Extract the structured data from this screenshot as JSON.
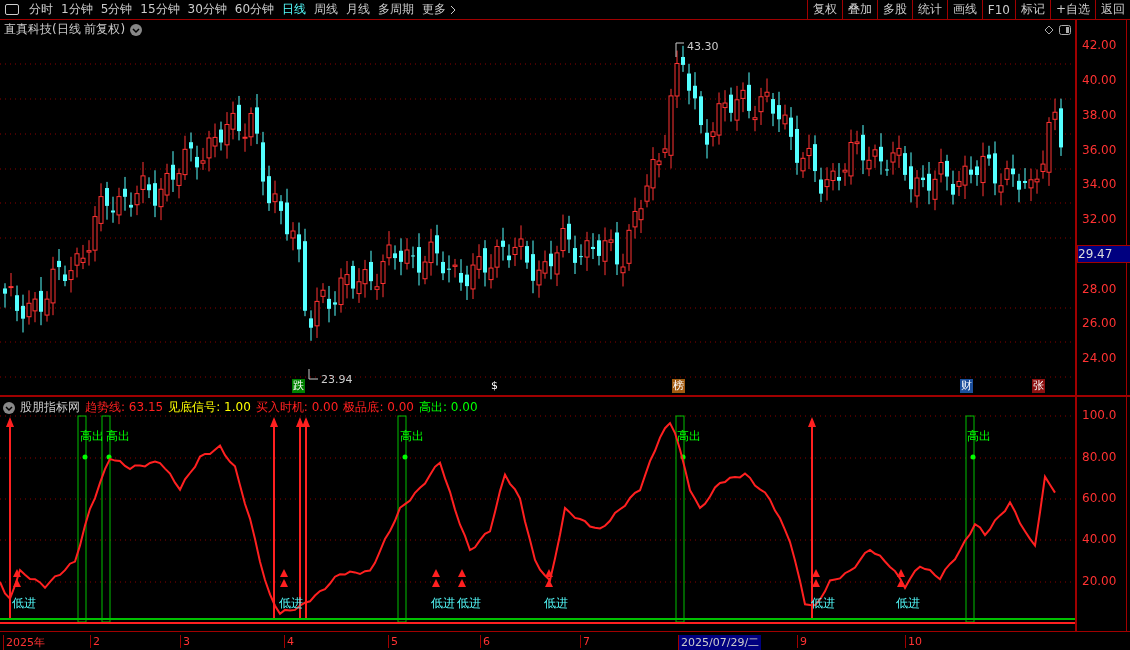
{
  "toolbar": {
    "periods": [
      {
        "label": "分时",
        "selected": false
      },
      {
        "label": "1分钟",
        "selected": false
      },
      {
        "label": "5分钟",
        "selected": false
      },
      {
        "label": "15分钟",
        "selected": false
      },
      {
        "label": "30分钟",
        "selected": false
      },
      {
        "label": "60分钟",
        "selected": false
      },
      {
        "label": "日线",
        "selected": true
      },
      {
        "label": "周线",
        "selected": false
      },
      {
        "label": "月线",
        "selected": false
      },
      {
        "label": "多周期",
        "selected": false
      },
      {
        "label": "更多",
        "selected": false
      }
    ],
    "buttons": [
      "复权",
      "叠加",
      "多股",
      "统计",
      "画线",
      "F10",
      "标记",
      "+自选",
      "返回"
    ]
  },
  "main_chart": {
    "title": "直真科技(日线 前复权)",
    "high_label": "43.30",
    "low_label": "23.94",
    "current_price": "29.47",
    "y_labels": [
      "42.00",
      "40.00",
      "38.00",
      "36.00",
      "34.00",
      "32.00",
      "28.00",
      "26.00",
      "24.00"
    ],
    "events": [
      {
        "label": "跌",
        "color": "#008000"
      },
      {
        "label": "$",
        "color": "#000000"
      },
      {
        "label": "榜",
        "color": "#a05a10"
      },
      {
        "label": "财",
        "color": "#1c4f9c"
      },
      {
        "label": "张",
        "color": "#8b1010"
      }
    ]
  },
  "indicator": {
    "name": "股朋指标网",
    "legend": [
      {
        "label": "趋势线: 63.15",
        "color": "#ff2020"
      },
      {
        "label": "见底信号: 1.00",
        "color": "#ffff00"
      },
      {
        "label": "买入时机: 0.00",
        "color": "#ff2020"
      },
      {
        "label": "极品底: 0.00",
        "color": "#ff2020"
      },
      {
        "label": "高出: 0.00",
        "color": "#00ff00"
      }
    ],
    "y_labels": [
      "100.0",
      "80.00",
      "60.00",
      "40.00",
      "20.00"
    ],
    "sell_marks": [
      "高出",
      "高出",
      "高出",
      "高出",
      "高出"
    ],
    "buy_marks": [
      "低进",
      "低进",
      "低进",
      "低进",
      "低进",
      "低进",
      "低进"
    ]
  },
  "date_axis": [
    {
      "label": "2025年",
      "selected": false
    },
    {
      "label": "2",
      "selected": false
    },
    {
      "label": "3",
      "selected": false
    },
    {
      "label": "4",
      "selected": false
    },
    {
      "label": "5",
      "selected": false
    },
    {
      "label": "6",
      "selected": false
    },
    {
      "label": "7",
      "selected": false
    },
    {
      "label": "2025/07/29/二",
      "selected": true
    },
    {
      "label": "9",
      "selected": false
    },
    {
      "label": "10",
      "selected": false
    }
  ]
}
